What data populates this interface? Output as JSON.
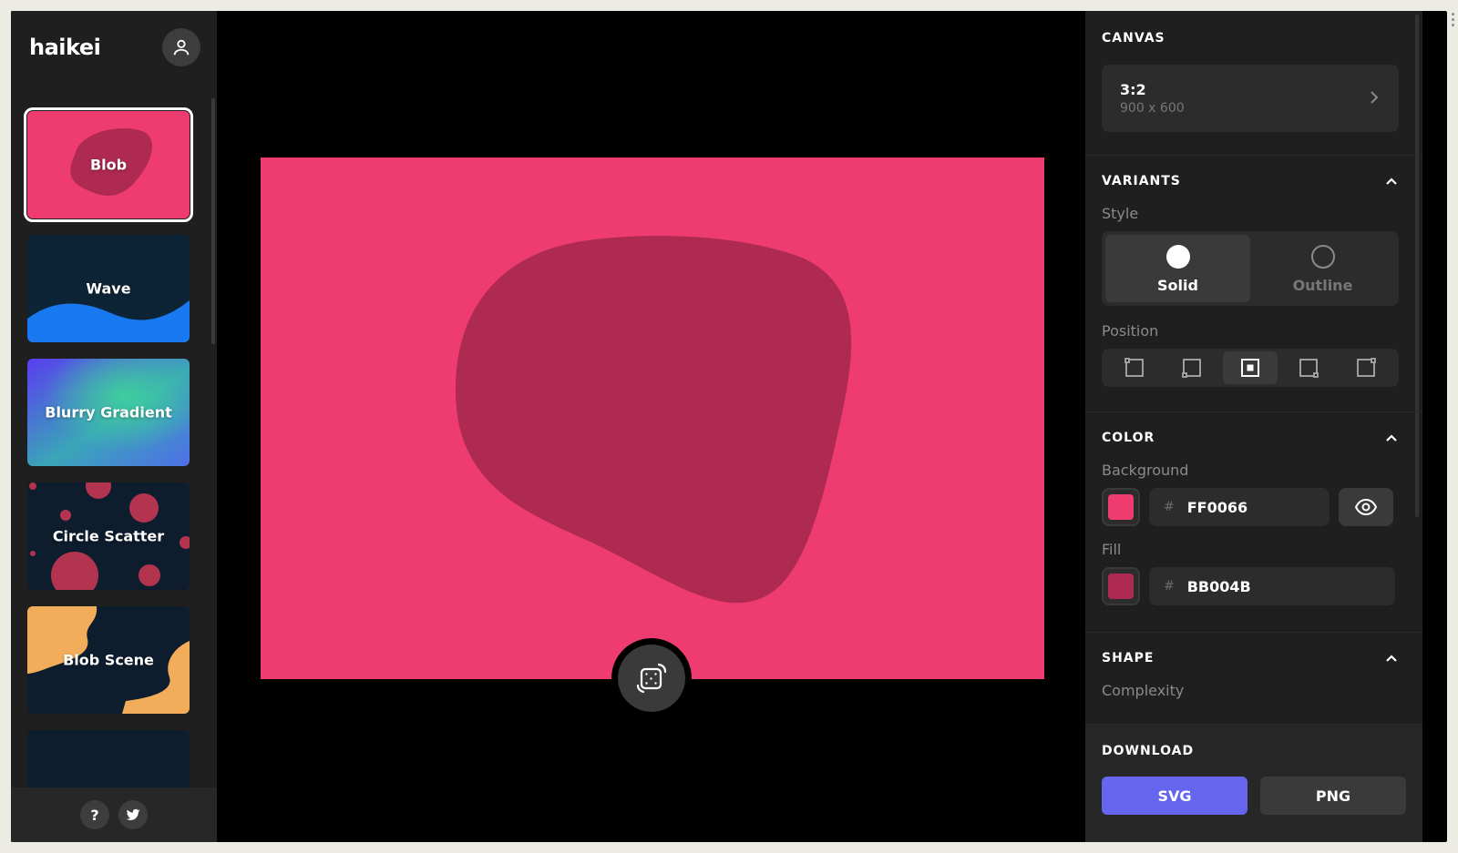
{
  "app": {
    "logo": "haikei"
  },
  "sidebar": {
    "generators": [
      {
        "label": "Blob",
        "selected": true
      },
      {
        "label": "Wave",
        "selected": false
      },
      {
        "label": "Blurry Gradient",
        "selected": false
      },
      {
        "label": "Circle Scatter",
        "selected": false
      },
      {
        "label": "Blob Scene",
        "selected": false
      }
    ],
    "footer": {
      "help_label": "?"
    }
  },
  "canvas": {
    "section_title": "CANVAS",
    "ratio": "3:2",
    "dimensions": "900 x 600"
  },
  "variants": {
    "section_title": "VARIANTS",
    "style_label": "Style",
    "style_options": [
      "Solid",
      "Outline"
    ],
    "selected_style": "Solid",
    "position_label": "Position",
    "position_options": [
      "top-left",
      "bottom-left",
      "center",
      "bottom-right",
      "top-right"
    ],
    "selected_position": "center"
  },
  "color": {
    "section_title": "COLOR",
    "background_label": "Background",
    "background_hex": "FF0066",
    "fill_label": "Fill",
    "fill_hex": "BB004B",
    "hash": "#"
  },
  "shape": {
    "section_title": "SHAPE",
    "complexity_label": "Complexity"
  },
  "download": {
    "section_title": "DOWNLOAD",
    "svg_label": "SVG",
    "png_label": "PNG"
  },
  "colors": {
    "artboard_bg": "#ee3c70",
    "blob_fill": "#ae2a53",
    "accent": "#6565ee"
  }
}
